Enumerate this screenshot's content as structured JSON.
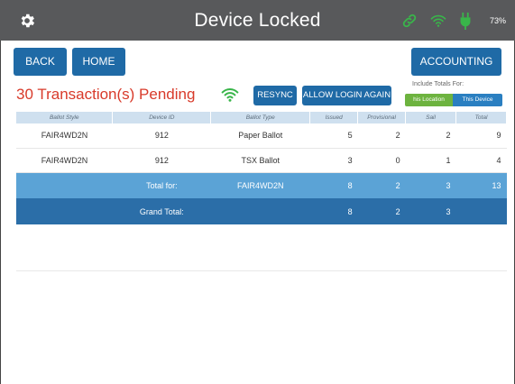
{
  "header": {
    "title": "Device Locked",
    "battery": "73%",
    "icons": [
      "gear-icon",
      "link-icon",
      "wifi-icon",
      "power-plug-icon"
    ],
    "colors": {
      "bar": "#58595b",
      "accent_green": "#39b54a"
    }
  },
  "nav": {
    "back_label": "BACK",
    "home_label": "HOME",
    "accounting_label": "ACCOUNTING"
  },
  "status": {
    "pending_text": "30 Transaction(s) Pending",
    "resync_label": "RESYNC",
    "allow_login_label": "ALLOW LOGIN AGAIN",
    "include_label": "Include Totals For:",
    "this_location_label": "his Location",
    "this_device_label": "This Device"
  },
  "table": {
    "columns": [
      "Ballot Style",
      "Device ID",
      "Ballot Type",
      "Issued",
      "Provisional",
      "Sail",
      "Total"
    ],
    "rows": [
      [
        "FAIR4WD2N",
        "912",
        "Paper Ballot",
        "5",
        "2",
        "2",
        "9"
      ],
      [
        "FAIR4WD2N",
        "912",
        "TSX Ballot",
        "3",
        "0",
        "1",
        "4"
      ]
    ],
    "total_row": {
      "label": "Total for:",
      "style": "FAIR4WD2N",
      "issued": "8",
      "provisional": "2",
      "sail": "3",
      "total": "13"
    },
    "grand_row": {
      "label": "Grand Total:",
      "issued": "8",
      "provisional": "2",
      "sail": "3"
    }
  }
}
